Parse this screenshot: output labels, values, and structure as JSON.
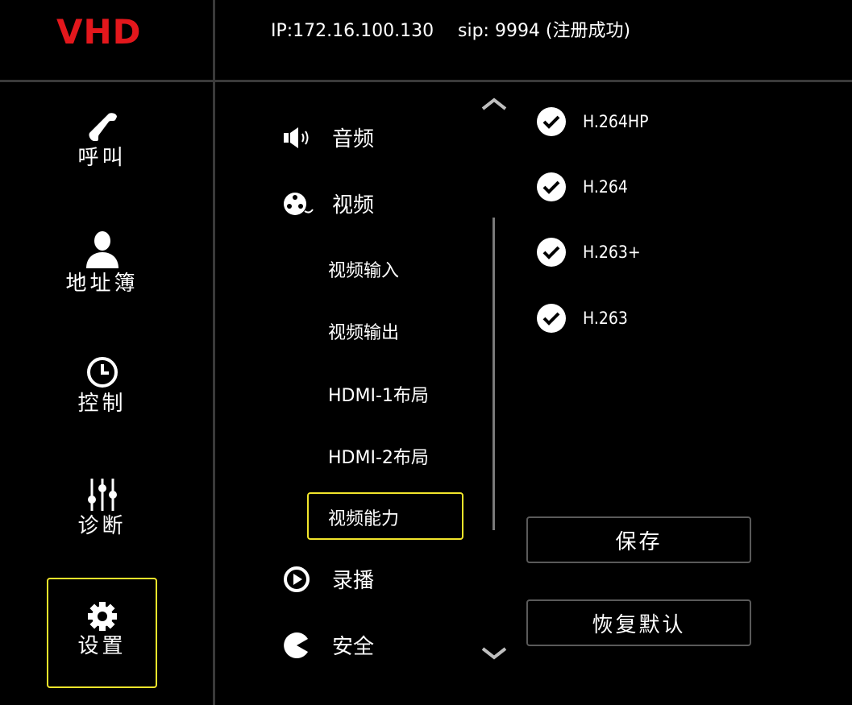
{
  "header": {
    "logo": "VHD",
    "ip": "IP:172.16.100.130",
    "sip": "sip: 9994 (注册成功)"
  },
  "nav": {
    "call": "呼叫",
    "address_book": "地址簿",
    "control": "控制",
    "diagnose": "诊断",
    "settings": "设置"
  },
  "menu": {
    "audio": "音频",
    "video": "视频",
    "video_sub": {
      "input": "视频输入",
      "output": "视频输出",
      "hdmi1": "HDMI-1布局",
      "hdmi2": "HDMI-2布局",
      "capability": "视频能力"
    },
    "record": "录播",
    "security": "安全"
  },
  "codecs": {
    "c1": "H.264HP",
    "c2": "H.264",
    "c3": "H.263+",
    "c4": "H.263"
  },
  "buttons": {
    "save": "保存",
    "restore": "恢复默认"
  },
  "colors": {
    "background": "#000000",
    "logo": "#e3171c",
    "highlight": "#f2e52b",
    "divider": "#3a3a3a"
  }
}
